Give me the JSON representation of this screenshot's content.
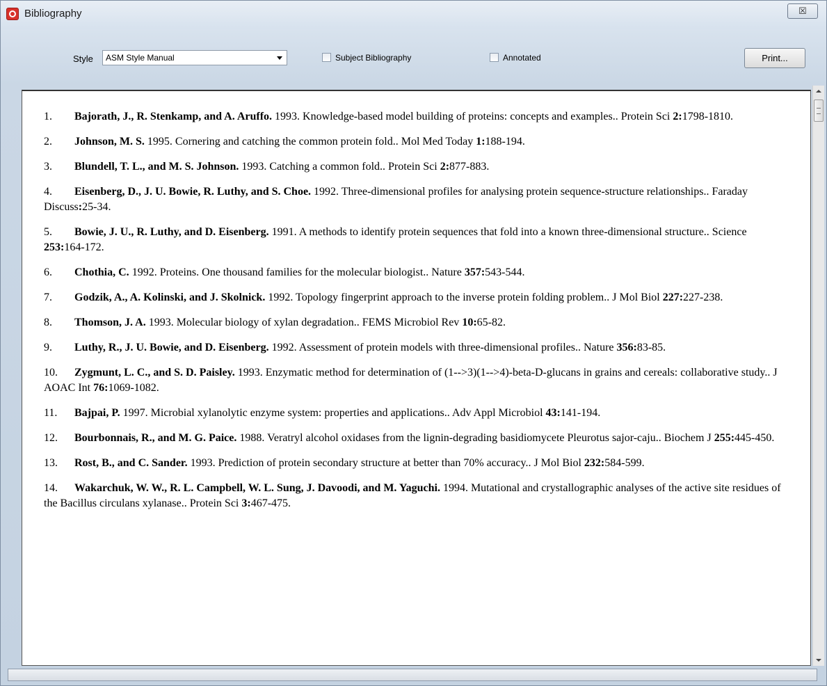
{
  "window": {
    "title": "Bibliography",
    "close_label": "☒"
  },
  "toolbar": {
    "style_label": "Style",
    "style_value": "ASM Style Manual",
    "subject_label": "Subject Bibliography",
    "annotated_label": "Annotated",
    "print_label": "Print..."
  },
  "references": [
    {
      "num": "1.",
      "authors": "Bajorath, J., R. Stenkamp, and A. Aruffo.",
      "pre": " 1993. Knowledge-based model building of proteins: concepts and examples.. Protein Sci ",
      "vol": "2:",
      "post": "1798-1810."
    },
    {
      "num": "2.",
      "authors": "Johnson, M. S.",
      "pre": " 1995. Cornering and catching the common protein fold.. Mol Med Today ",
      "vol": "1:",
      "post": "188-194."
    },
    {
      "num": "3.",
      "authors": "Blundell, T. L., and M. S. Johnson.",
      "pre": " 1993. Catching a common fold.. Protein Sci ",
      "vol": "2:",
      "post": "877-883."
    },
    {
      "num": "4.",
      "authors": "Eisenberg, D., J. U. Bowie, R. Luthy, and S. Choe.",
      "pre": " 1992. Three-dimensional profiles for analysing protein sequence-structure relationships.. Faraday Discuss",
      "vol": ":",
      "post": "25-34."
    },
    {
      "num": "5.",
      "authors": "Bowie, J. U., R. Luthy, and D. Eisenberg.",
      "pre": " 1991. A methods to identify protein sequences that fold into a known three-dimensional structure.. Science ",
      "vol": "253:",
      "post": "164-172."
    },
    {
      "num": "6.",
      "authors": "Chothia, C.",
      "pre": " 1992. Proteins. One thousand families for the molecular biologist.. Nature ",
      "vol": "357:",
      "post": "543-544."
    },
    {
      "num": "7.",
      "authors": "Godzik, A., A. Kolinski, and J. Skolnick.",
      "pre": " 1992. Topology fingerprint approach to the inverse protein folding problem.. J Mol Biol ",
      "vol": "227:",
      "post": "227-238."
    },
    {
      "num": "8.",
      "authors": "Thomson, J. A.",
      "pre": " 1993. Molecular biology of xylan degradation.. FEMS Microbiol Rev ",
      "vol": "10:",
      "post": "65-82."
    },
    {
      "num": "9.",
      "authors": "Luthy, R., J. U. Bowie, and D. Eisenberg.",
      "pre": " 1992. Assessment of protein models with three-dimensional profiles.. Nature ",
      "vol": "356:",
      "post": "83-85."
    },
    {
      "num": "10.",
      "authors": "Zygmunt, L. C., and S. D. Paisley.",
      "pre": " 1993. Enzymatic method for determination of (1-->3)(1-->4)-beta-D-glucans in grains and cereals: collaborative study.. J AOAC Int ",
      "vol": "76:",
      "post": "1069-1082."
    },
    {
      "num": "11.",
      "authors": "Bajpai, P.",
      "pre": " 1997. Microbial xylanolytic enzyme system: properties and applications.. Adv Appl Microbiol ",
      "vol": "43:",
      "post": "141-194."
    },
    {
      "num": "12.",
      "authors": "Bourbonnais, R., and M. G. Paice.",
      "pre": " 1988. Veratryl alcohol oxidases from the lignin-degrading basidiomycete Pleurotus sajor-caju.. Biochem J ",
      "vol": "255:",
      "post": "445-450."
    },
    {
      "num": "13.",
      "authors": "Rost, B., and C. Sander.",
      "pre": " 1993. Prediction of protein secondary structure at better than 70% accuracy.. J Mol Biol ",
      "vol": "232:",
      "post": "584-599."
    },
    {
      "num": "14.",
      "authors": "Wakarchuk, W. W., R. L. Campbell, W. L. Sung, J. Davoodi, and M. Yaguchi.",
      "pre": " 1994. Mutational and crystallographic analyses of the active site residues of the Bacillus circulans xylanase.. Protein Sci ",
      "vol": "3:",
      "post": "467-475."
    }
  ]
}
